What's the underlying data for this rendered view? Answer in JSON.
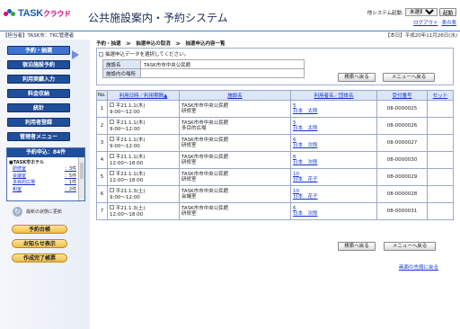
{
  "header": {
    "logo_main": "TASK",
    "logo_sub": "クラウド",
    "title": "公共施設案内・予約システム",
    "other_system_label": "他システム起動:",
    "other_system_value": "未選択",
    "launch_button": "起動",
    "logout_link": "ログアウト",
    "bottom_link": "表の表"
  },
  "topbar": {
    "left": "【担当者】TASK市：TKC管理者",
    "right": "【本日】平成20年11月26日(水)"
  },
  "sidebar": {
    "nav": [
      {
        "label": "予約・抽選"
      },
      {
        "label": "宿泊施設予約"
      },
      {
        "label": "利用実績入力"
      },
      {
        "label": "料金収納"
      },
      {
        "label": "統計"
      },
      {
        "label": "利用者登録"
      },
      {
        "label": "管理者メニュー"
      }
    ],
    "panel_title": "予約申込：84件",
    "panel_group": "■TASK市ホテル",
    "panel_rows": [
      {
        "name": "研修室",
        "count": "：3件"
      },
      {
        "name": "会議室",
        "count": "：5件"
      },
      {
        "name": "多目的広場",
        "count": "：1件"
      },
      {
        "name": "和室",
        "count": "：2件"
      }
    ],
    "refresh_label": "最新の状態に更新",
    "buttons": [
      {
        "label": "予約台帳"
      },
      {
        "label": "お知らせ表示"
      },
      {
        "label": "作成完了帳票"
      }
    ]
  },
  "main": {
    "breadcrumb": "予約・抽選　≫　抽選申込の取消　≫　抽選申込内容一覧",
    "info_message": "抽選申込データを選択してください。",
    "info_rows": [
      {
        "key": "施設名",
        "value": "TASK市市中央公民館"
      },
      {
        "key": "施設内の場所",
        "value": ""
      }
    ],
    "search_back_button": "検索へ戻る",
    "menu_back_button": "メニューへ戻る",
    "columns": [
      "No.",
      "利用日時／利用期間▲",
      "施設名",
      "利用者名／団体名",
      "受付番号",
      "セット"
    ],
    "rows": [
      {
        "no": "1",
        "date": "平21.1.1(木)",
        "time": "9:00～12:00",
        "facility": "TASK市市中央公民館",
        "room": "研修室",
        "uid": "5",
        "user": "日本　太郎",
        "receipt": "08-0000025"
      },
      {
        "no": "2",
        "date": "平21.1.1(木)",
        "time": "9:00～12:00",
        "facility": "TASK市市中央公民館",
        "room": "多目的広場",
        "uid": "5",
        "user": "日本　太郎",
        "receipt": "08-0000026"
      },
      {
        "no": "3",
        "date": "平21.1.1(木)",
        "time": "9:00～12:00",
        "facility": "TASK市市中央公民館",
        "room": "研修室",
        "uid": "6",
        "user": "日本　次郎",
        "receipt": "08-0000027"
      },
      {
        "no": "4",
        "date": "平21.1.1(木)",
        "time": "12:00～18:00",
        "facility": "TASK市市中央公民館",
        "room": "研修室",
        "uid": "6",
        "user": "日本　次郎",
        "receipt": "08-0000030"
      },
      {
        "no": "5",
        "date": "平21.1.1(木)",
        "time": "12:00～18:00",
        "facility": "TASK市市中央公民館",
        "room": "研修室",
        "uid": "10",
        "user": "日本　花子",
        "receipt": "08-0000029"
      },
      {
        "no": "6",
        "date": "平21.1.3(土)",
        "time": "9:00～12:00",
        "facility": "TASK市市中央公民館",
        "room": "会議室",
        "uid": "10",
        "user": "日本　花子",
        "receipt": "08-0000028"
      },
      {
        "no": "7",
        "date": "平21.1.3(土)",
        "time": "12:00～18:00",
        "facility": "TASK市市中央公民館",
        "room": "研修室",
        "uid": "6",
        "user": "日本　次郎",
        "receipt": "08-0000031"
      }
    ],
    "page_top_link": "画面の先頭に戻る"
  }
}
